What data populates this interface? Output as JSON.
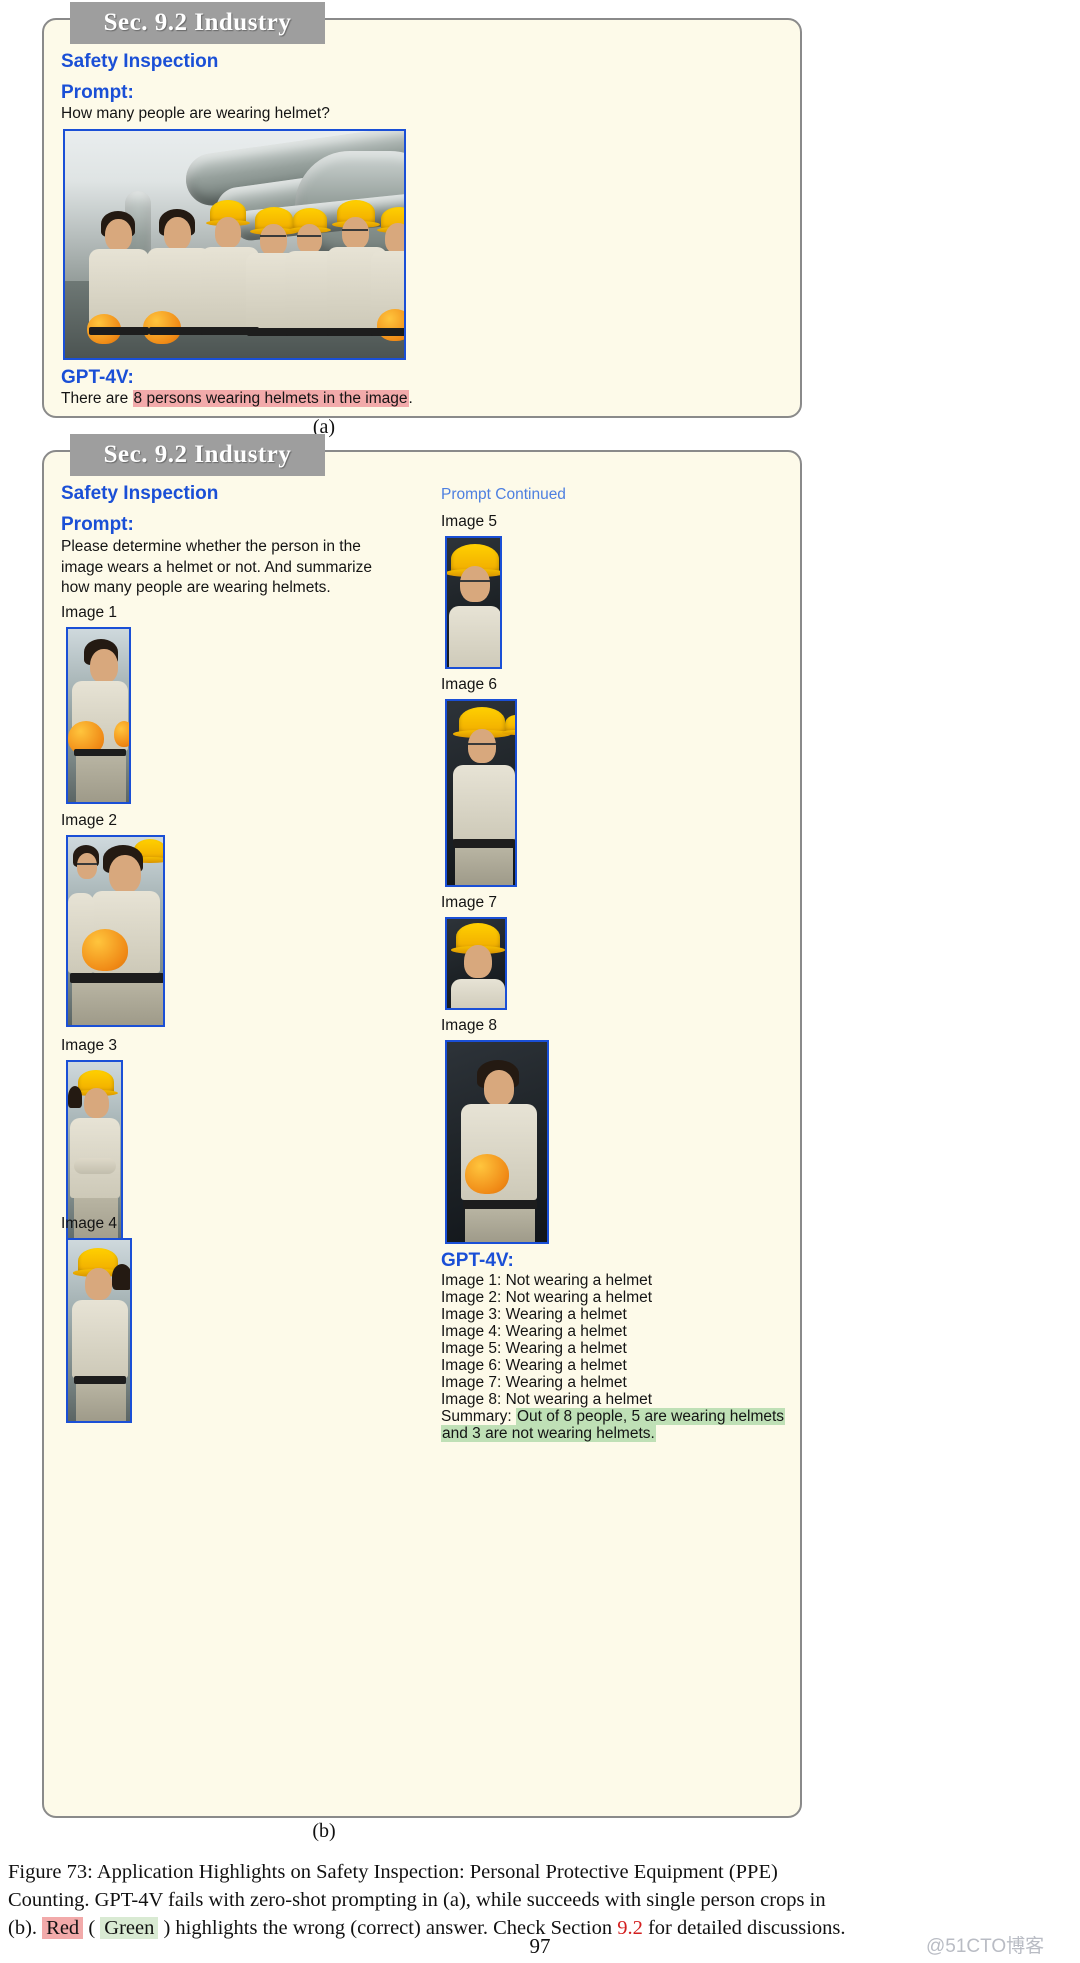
{
  "panel_a": {
    "tab_title": "Sec. 9.2 Industry",
    "section_title": "Safety Inspection",
    "prompt_label": "Prompt:",
    "prompt_text": "How many people are wearing helmet?",
    "gpt_label": "GPT-4V:",
    "answer_prefix": "There are ",
    "answer_highlight": "8 persons wearing helmets in the image",
    "answer_suffix": ".",
    "subcaption": "(a)",
    "photo_name": "group-of-workers-photo"
  },
  "panel_b": {
    "tab_title": "Sec. 9.2 Industry",
    "section_title": "Safety Inspection",
    "prompt_label": "Prompt:",
    "prompt_text": "Please determine whether the person in the\nimage wears a helmet or not. And summarize\nhow many people are wearing helmets.",
    "prompt_continued_label": "Prompt Continued",
    "image_captions": {
      "img1": "Image 1",
      "img2": "Image 2",
      "img3": "Image 3",
      "img4": "Image 4",
      "img5": "Image 5",
      "img6": "Image 6",
      "img7": "Image 7",
      "img8": "Image 8"
    },
    "gpt_label": "GPT-4V:",
    "answers": [
      "Image 1: Not wearing a helmet",
      "Image 2: Not wearing a helmet",
      "Image 3: Wearing a helmet",
      "Image 4: Wearing a helmet",
      "Image 5: Wearing a helmet",
      "Image 6: Wearing a helmet",
      "Image 7: Wearing a helmet",
      "Image 8: Not wearing a helmet"
    ],
    "summary_prefix": "Summary: ",
    "summary_highlight_line1": "Out of 8 people, 5 are wearing helmets",
    "summary_highlight_line2": "and 3 are not wearing helmets.",
    "subcaption": "(b)"
  },
  "figure_caption": {
    "line1_part1": "Figure 73: ",
    "line1_part2": "Application Highlights on Safety Inspection:  Personal Protective Equipment (PPE)",
    "line2": "Counting. GPT-4V fails with zero-shot prompting in (a), while succeeds with single person crops in",
    "line3_a": "(b). ",
    "line3_red": "Red",
    "line3_b": " ( ",
    "line3_green": "Green",
    "line3_c": " ) highlights the wrong (correct) answer. Check Section ",
    "line3_sec": "9.2",
    "line3_d": " for detailed discussions."
  },
  "page_number": "97",
  "watermark": "@51CTO博客",
  "colors": {
    "panel_bg": "#fdfae9",
    "panel_border": "#8a8a8a",
    "tab_bg": "#9e9e9e",
    "accent_blue": "#1a4fd6",
    "light_blue": "#4d7fe0",
    "highlight_red": "#f2aaaa",
    "highlight_green": "#bfe0b6",
    "section_ref_red": "#d31f1f"
  }
}
